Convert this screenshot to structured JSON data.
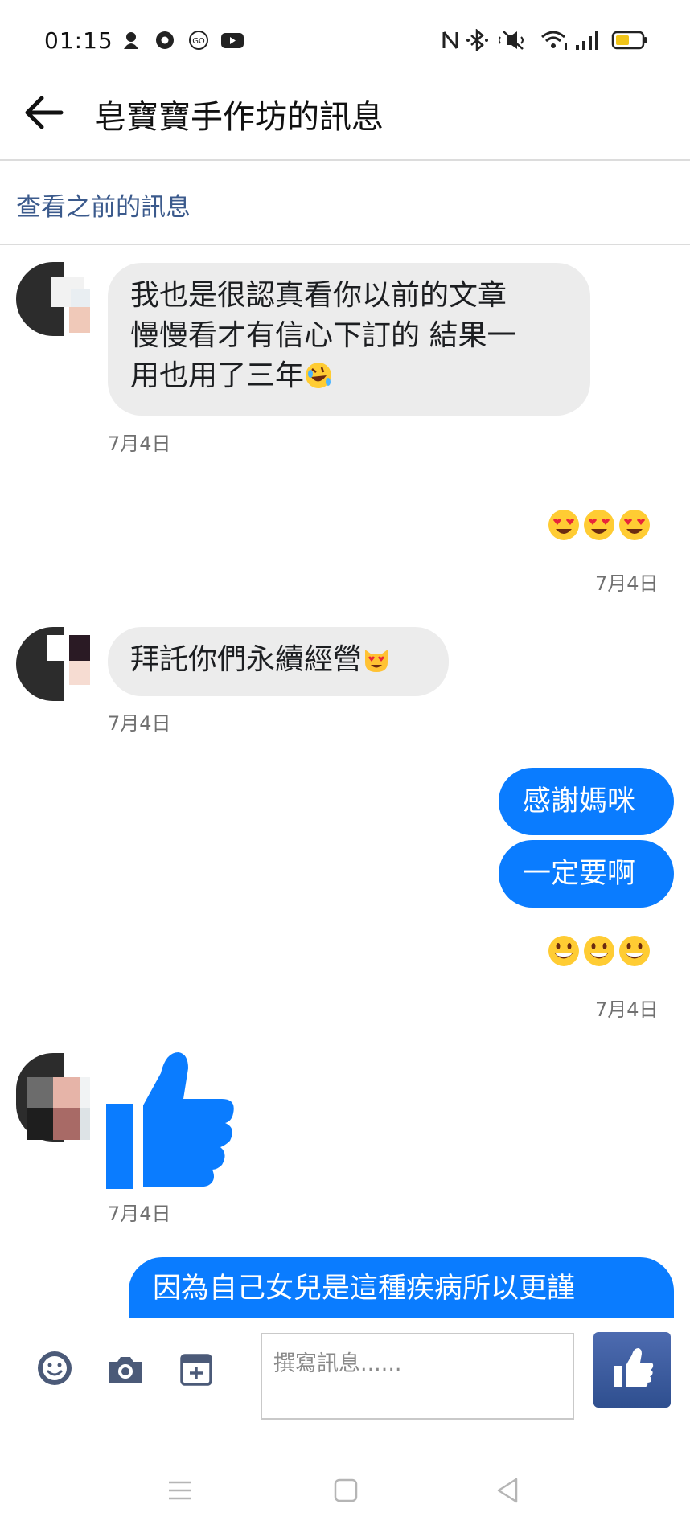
{
  "status_bar": {
    "time": "01:15"
  },
  "header": {
    "title": "皂寶寶手作坊的訊息"
  },
  "see_previous": "查看之前的訊息",
  "messages": [
    {
      "direction": "incoming",
      "lines": [
        "我也是很認真看你以前的文章",
        "慢慢看才有信心下訂的 結果一",
        "用也用了三年"
      ],
      "trailing_emoji": "rolling-on-floor-laughing-emoji"
    },
    {
      "direction": "incoming_date",
      "text": "7月4日"
    },
    {
      "direction": "outgoing_emoji",
      "emojis": [
        "heart-eyes-emoji",
        "heart-eyes-emoji",
        "heart-eyes-emoji"
      ]
    },
    {
      "direction": "outgoing_date",
      "text": "7月4日"
    },
    {
      "direction": "incoming",
      "text": "拜託你們永續經營",
      "trailing_emoji": "heart-eyes-cat-emoji"
    },
    {
      "direction": "incoming_date",
      "text": "7月4日"
    },
    {
      "direction": "outgoing",
      "text": "感謝媽咪"
    },
    {
      "direction": "outgoing",
      "text": "一定要啊"
    },
    {
      "direction": "outgoing_emoji",
      "emojis": [
        "grinning-face-emoji",
        "grinning-face-emoji",
        "grinning-face-emoji"
      ]
    },
    {
      "direction": "outgoing_date",
      "text": "7月4日"
    },
    {
      "direction": "incoming_like",
      "icon": "thumbs-up-icon"
    },
    {
      "direction": "incoming_date",
      "text": "7月4日"
    },
    {
      "direction": "outgoing_partial",
      "text": "因為自己女兒是這種疾病所以更謹"
    }
  ],
  "composer": {
    "placeholder": "撰寫訊息......"
  },
  "colors": {
    "outgoing_bubble": "#0a7cff",
    "incoming_bubble": "#ececec",
    "link": "#3b5a8c",
    "send_button": "#3b5998"
  }
}
